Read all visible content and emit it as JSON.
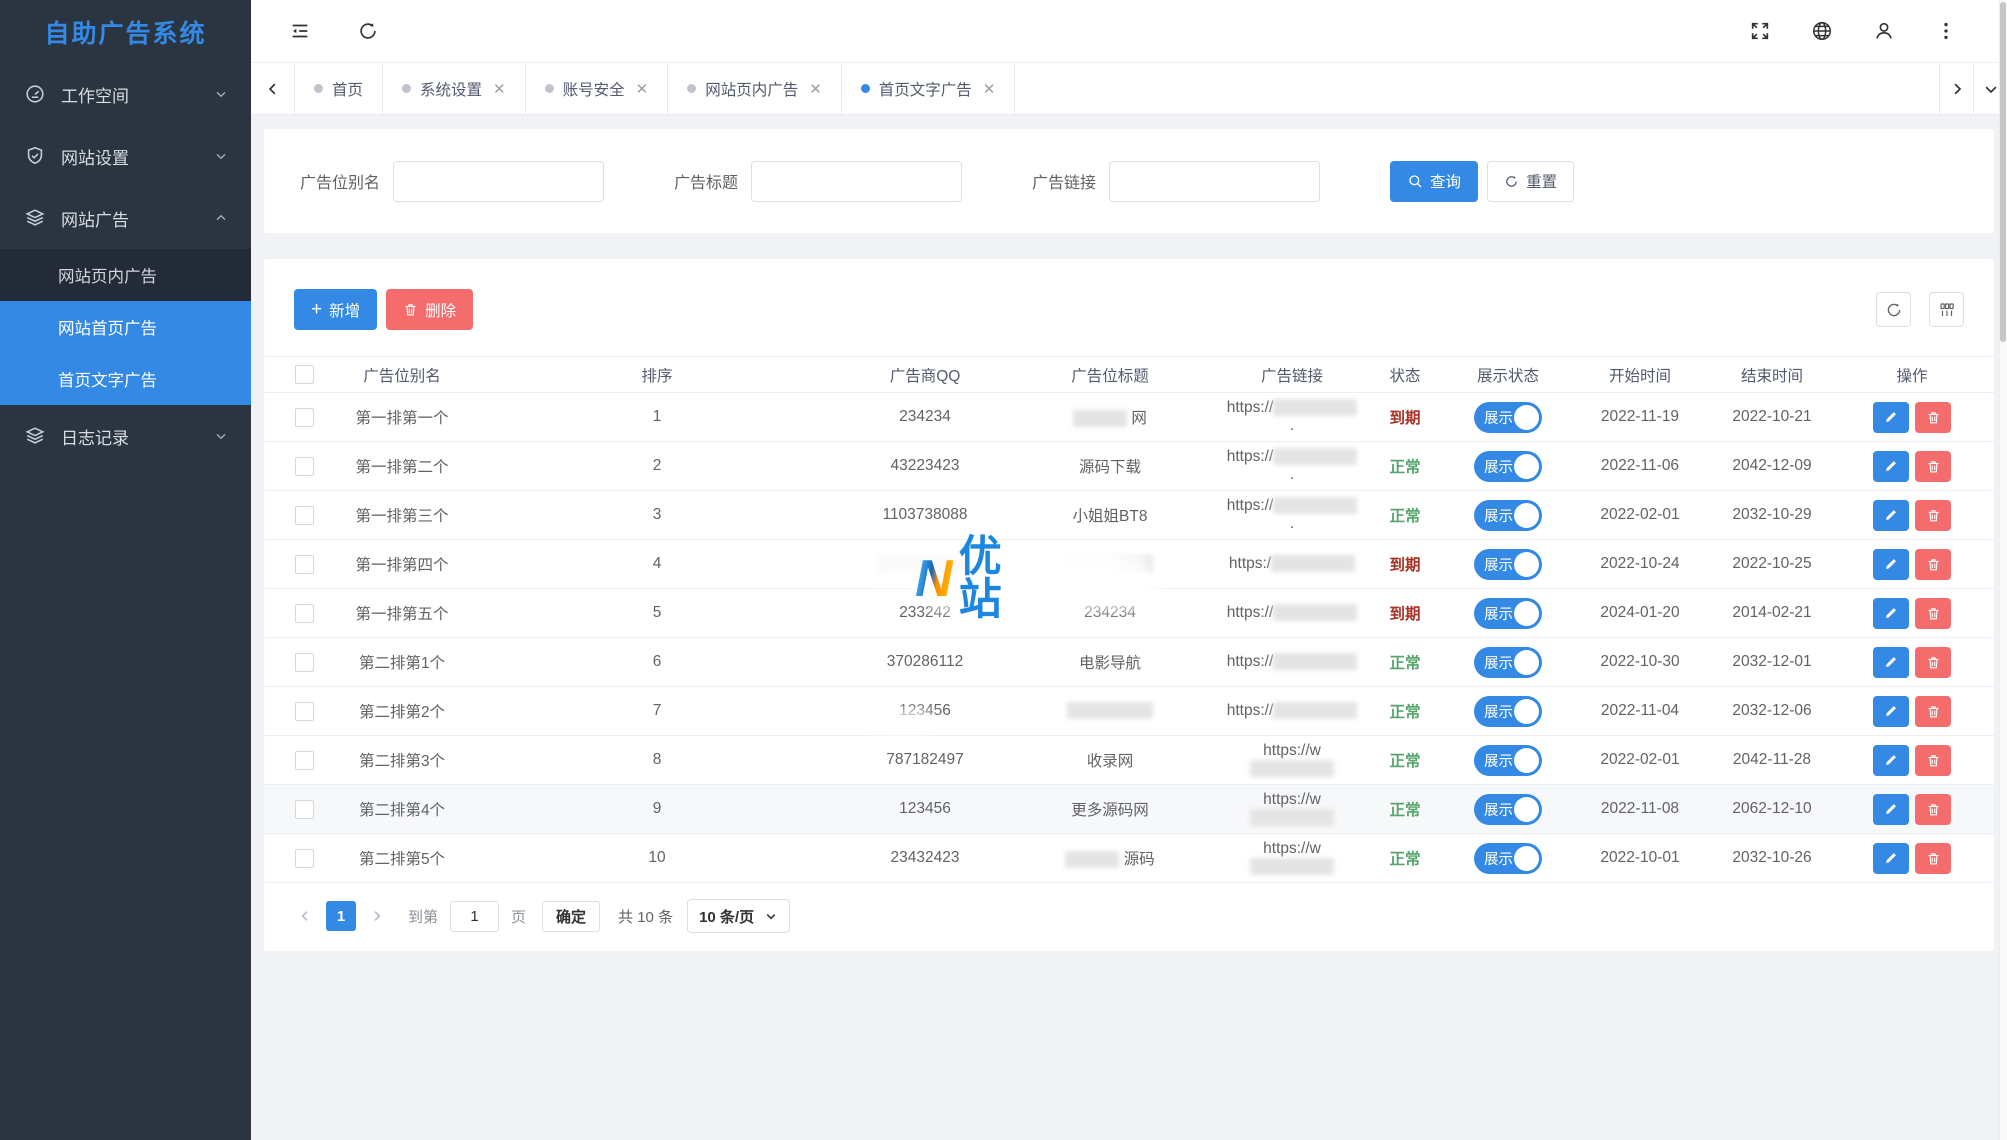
{
  "app": {
    "title": "自助广告系统"
  },
  "colors": {
    "accent": "#3389e3",
    "danger": "#f56c6c",
    "sidebar_bg": "#2b3441",
    "status_expired": "#a93226",
    "status_normal": "#57a56d"
  },
  "sidebar": {
    "items": [
      {
        "label": "工作空间",
        "icon": "gauge",
        "expanded": false
      },
      {
        "label": "网站设置",
        "icon": "shield-check",
        "expanded": false
      },
      {
        "label": "网站广告",
        "icon": "layers",
        "expanded": true,
        "children": [
          {
            "label": "网站页内广告",
            "active": false
          },
          {
            "label": "网站首页广告",
            "active": true
          },
          {
            "label": "首页文字广告",
            "active": true
          }
        ]
      },
      {
        "label": "日志记录",
        "icon": "layers",
        "expanded": false
      }
    ]
  },
  "tabs": [
    {
      "label": "首页",
      "active": false,
      "closable": false
    },
    {
      "label": "系统设置",
      "active": false,
      "closable": true
    },
    {
      "label": "账号安全",
      "active": false,
      "closable": true
    },
    {
      "label": "网站页内广告",
      "active": false,
      "closable": true
    },
    {
      "label": "首页文字广告",
      "active": true,
      "closable": true
    }
  ],
  "search": {
    "fields": [
      {
        "label": "广告位别名",
        "value": ""
      },
      {
        "label": "广告标题",
        "value": ""
      },
      {
        "label": "广告链接",
        "value": ""
      }
    ],
    "query_label": "查询",
    "reset_label": "重置"
  },
  "toolbar": {
    "add_label": "新增",
    "delete_label": "删除"
  },
  "table": {
    "toggle_label": "展示",
    "columns": [
      "广告位别名",
      "排序",
      "广告商QQ",
      "广告位标题",
      "广告链接",
      "状态",
      "展示状态",
      "开始时间",
      "结束时间",
      "操作"
    ],
    "rows": [
      {
        "alias": "第一排第一个",
        "order": "1",
        "qq": "234234",
        "qq_blur": false,
        "title": "网",
        "title_blur": "before",
        "link_prefix": "https://",
        "link_dot": true,
        "status": "到期",
        "status_type": "expired",
        "start": "2022-11-19",
        "end": "2022-10-21",
        "highlight": false
      },
      {
        "alias": "第一排第二个",
        "order": "2",
        "qq": "43223423",
        "qq_blur": false,
        "title": "源码下载",
        "title_blur": "none",
        "link_prefix": "https://",
        "link_dot": true,
        "status": "正常",
        "status_type": "normal",
        "start": "2022-11-06",
        "end": "2042-12-09",
        "highlight": false
      },
      {
        "alias": "第一排第三个",
        "order": "3",
        "qq": "1103738088",
        "qq_blur": false,
        "title": "小姐姐BT8",
        "title_blur": "none",
        "link_prefix": "https://",
        "link_dot": true,
        "status": "正常",
        "status_type": "normal",
        "start": "2022-02-01",
        "end": "2032-10-29",
        "highlight": false
      },
      {
        "alias": "第一排第四个",
        "order": "4",
        "qq": "",
        "qq_blur": true,
        "title": "",
        "title_blur": "full",
        "link_prefix": "https:/",
        "link_dot": false,
        "status": "到期",
        "status_type": "expired",
        "start": "2022-10-24",
        "end": "2022-10-25",
        "highlight": false
      },
      {
        "alias": "第一排第五个",
        "order": "5",
        "qq": "233242",
        "qq_blur": false,
        "title": "234234",
        "title_blur": "none",
        "link_prefix": "https://",
        "link_dot": false,
        "status": "到期",
        "status_type": "expired",
        "start": "2024-01-20",
        "end": "2014-02-21",
        "highlight": false
      },
      {
        "alias": "第二排第1个",
        "order": "6",
        "qq": "370286112",
        "qq_blur": false,
        "title": "电影导航",
        "title_blur": "none",
        "link_prefix": "https://",
        "link_dot": false,
        "status": "正常",
        "status_type": "normal",
        "start": "2022-10-30",
        "end": "2032-12-01",
        "highlight": false
      },
      {
        "alias": "第二排第2个",
        "order": "7",
        "qq": "123456",
        "qq_blur": false,
        "title": "",
        "title_blur": "full",
        "link_prefix": "https://",
        "link_dot": false,
        "status": "正常",
        "status_type": "normal",
        "start": "2022-11-04",
        "end": "2032-12-06",
        "highlight": false
      },
      {
        "alias": "第二排第3个",
        "order": "8",
        "qq": "787182497",
        "qq_blur": false,
        "title": "收录网",
        "title_blur": "none",
        "link_prefix": "https://w",
        "link_dot": false,
        "status": "正常",
        "status_type": "normal",
        "start": "2022-02-01",
        "end": "2042-11-28",
        "highlight": false
      },
      {
        "alias": "第二排第4个",
        "order": "9",
        "qq": "123456",
        "qq_blur": false,
        "title": "更多源码网",
        "title_blur": "none",
        "link_prefix": "https://w",
        "link_dot": false,
        "status": "正常",
        "status_type": "normal",
        "start": "2022-11-08",
        "end": "2062-12-10",
        "highlight": true
      },
      {
        "alias": "第二排第5个",
        "order": "10",
        "qq": "23432423",
        "qq_blur": false,
        "title": "源码",
        "title_blur": "before",
        "link_prefix": "https://w",
        "link_dot": false,
        "status": "正常",
        "status_type": "normal",
        "start": "2022-10-01",
        "end": "2032-10-26",
        "highlight": false
      }
    ]
  },
  "pagination": {
    "page": "1",
    "goto_label": "到第",
    "goto_value": "1",
    "page_unit": "页",
    "confirm_label": "确定",
    "total_label": "共 10 条",
    "size_label": "10 条/页"
  },
  "watermark": {
    "letter": "N",
    "brand": "优站"
  }
}
